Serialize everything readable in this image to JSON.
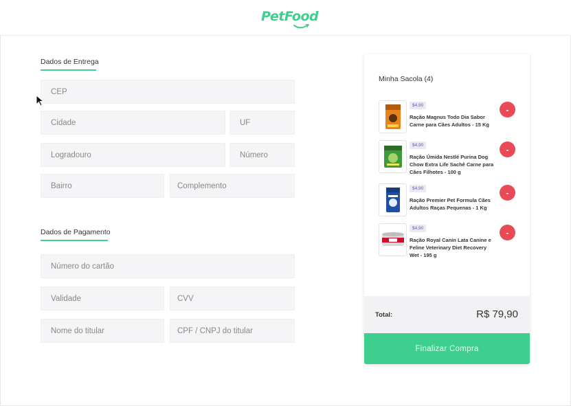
{
  "brand": {
    "logo_text": "PetFood",
    "accent": "#3ecf8e"
  },
  "delivery": {
    "title": "Dados de Entrega",
    "fields": {
      "cep": "CEP",
      "cidade": "Cidade",
      "uf": "UF",
      "logradouro": "Logradouro",
      "numero": "Número",
      "bairro": "Bairro",
      "complemento": "Complemento"
    }
  },
  "payment": {
    "title": "Dados de Pagamento",
    "fields": {
      "numero_cartao": "Número do cartão",
      "validade": "Validade",
      "cvv": "CVV",
      "nome_titular": "Nome do titular",
      "cpf_cnpj": "CPF / CNPJ do titular"
    }
  },
  "cart": {
    "title": "Minha Sacola (4)",
    "items": [
      {
        "price": "$4,90",
        "name": "Ração Magnus Todo Dia Sabor Carne para Cães Adultos - 15 Kg",
        "remove": "-",
        "thumb": "orange-bag-icon"
      },
      {
        "price": "$4,90",
        "name": "Ração Úmida Nestlé Purina Dog Chow Extra Life Sachê Carne para Cães Filhotes - 100 g",
        "remove": "-",
        "thumb": "green-sachet-icon"
      },
      {
        "price": "$4,90",
        "name": "Ração Premier Pet Formula Cães Adultos Raças Pequenas - 1 Kg",
        "remove": "-",
        "thumb": "blue-bag-icon"
      },
      {
        "price": "$4,90",
        "name": "Ração Royal Canin Lata Canine e Feline Veterinary Diet Recovery Wet - 195 g",
        "remove": "-",
        "thumb": "can-icon"
      }
    ],
    "total_label": "Total:",
    "total_value": "R$ 79,90",
    "checkout_label": "Finalizar Compra",
    "remove_color": "#e94a55"
  }
}
